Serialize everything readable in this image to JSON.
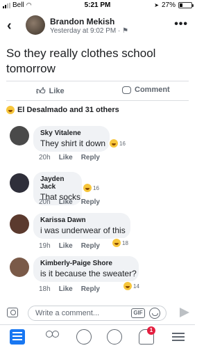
{
  "status_bar": {
    "carrier": "Bell",
    "time": "5:21 PM",
    "battery": "27%",
    "battery_level": 0.27
  },
  "post": {
    "author": "Brandon Mekish",
    "timestamp": "Yesterday at 9:02 PM",
    "text": "So they really clothes school tomorrow"
  },
  "actions": {
    "like": "Like",
    "comment": "Comment"
  },
  "reactions_summary": "El Desalmado and 31 others",
  "comments": [
    {
      "name": "Sky Vitalene",
      "text": "They shirt it down",
      "time": "20h",
      "like": "Like",
      "reply": "Reply",
      "reactions": "16"
    },
    {
      "name": "Jayden Jack",
      "text": "That socks",
      "time": "20h",
      "like": "Like",
      "reply": "Reply",
      "reactions": "16"
    },
    {
      "name": "Karissa Dawn",
      "text": "i was underwear of this",
      "time": "19h",
      "like": "Like",
      "reply": "Reply",
      "reactions": "18"
    },
    {
      "name": "Kimberly-Paige Shore",
      "text": "is it because the sweater?",
      "time": "18h",
      "like": "Like",
      "reply": "Reply",
      "reactions": "14"
    }
  ],
  "composer": {
    "placeholder": "Write a comment...",
    "gif": "GIF"
  },
  "tabbar": {
    "notifications_badge": "1"
  },
  "icons": [
    "back-icon",
    "more-icon",
    "like-icon",
    "comment-icon",
    "haha-emoji-icon",
    "camera-icon",
    "gif-icon",
    "emoji-icon",
    "send-icon",
    "news-feed-icon",
    "friends-icon",
    "watch-icon",
    "groups-icon",
    "notifications-icon",
    "menu-icon"
  ],
  "colors": {
    "accent": "#1877f2",
    "badge": "#e41e3f",
    "bubble": "#f0f2f5"
  }
}
